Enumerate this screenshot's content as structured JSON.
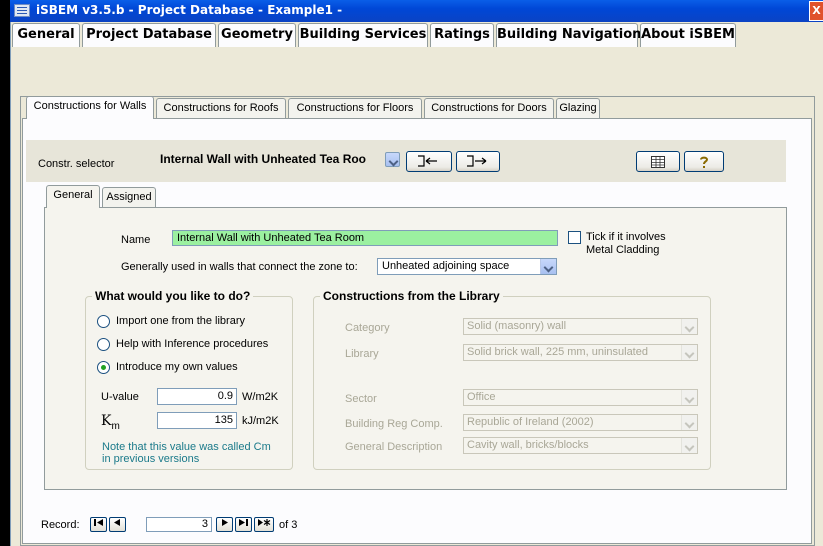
{
  "window": {
    "title": "iSBEM v3.5.b - Project Database - Example1 -",
    "close_glyph": "X"
  },
  "main_tabs": [
    {
      "label": "General"
    },
    {
      "label": "Project Database"
    },
    {
      "label": "Geometry"
    },
    {
      "label": "Building Services"
    },
    {
      "label": "Ratings"
    },
    {
      "label": "Building Navigation"
    },
    {
      "label": "About iSBEM"
    }
  ],
  "construction_tabs": [
    {
      "label": "Constructions for Walls"
    },
    {
      "label": "Constructions for Roofs"
    },
    {
      "label": "Constructions for Floors"
    },
    {
      "label": "Constructions for Doors"
    },
    {
      "label": "Glazing"
    }
  ],
  "selector": {
    "label": "Constr. selector",
    "value": "Internal Wall with Unheated Tea Roo"
  },
  "sub_tabs": [
    {
      "label": "General"
    },
    {
      "label": "Assigned"
    }
  ],
  "general": {
    "name_label": "Name",
    "name_value": "Internal Wall with Unheated Tea Room",
    "metal_cladding_label_1": "Tick if it involves",
    "metal_cladding_label_2": "Metal Cladding",
    "connect_label": "Generally used in walls that connect the zone to:",
    "connect_value": "Unheated adjoining space"
  },
  "todo": {
    "title": "What would you like to do?",
    "option_import": "Import one from the library",
    "option_inference": "Help with Inference procedures",
    "option_own": "Introduce my own values",
    "u_label": "U-value",
    "u_value": "0.9",
    "u_unit": "W/m2K",
    "km_label": "K",
    "km_sub": "m",
    "km_value": "135",
    "km_unit": "kJ/m2K",
    "note_1": "Note that this value was called Cm",
    "note_2": "in previous versions"
  },
  "library": {
    "title": "Constructions from the Library",
    "category_label": "Category",
    "category_value": "Solid (masonry) wall",
    "library_label": "Library",
    "library_value": "Solid brick wall, 225 mm, uninsulated",
    "sector_label": "Sector",
    "sector_value": "Office",
    "regs_label": "Building Reg Comp.",
    "regs_value": "Republic of Ireland (2002)",
    "desc_label": "General Description",
    "desc_value": "Cavity wall, bricks/blocks"
  },
  "record_nav": {
    "label": "Record:",
    "current": "3",
    "of_text": "of 3"
  }
}
